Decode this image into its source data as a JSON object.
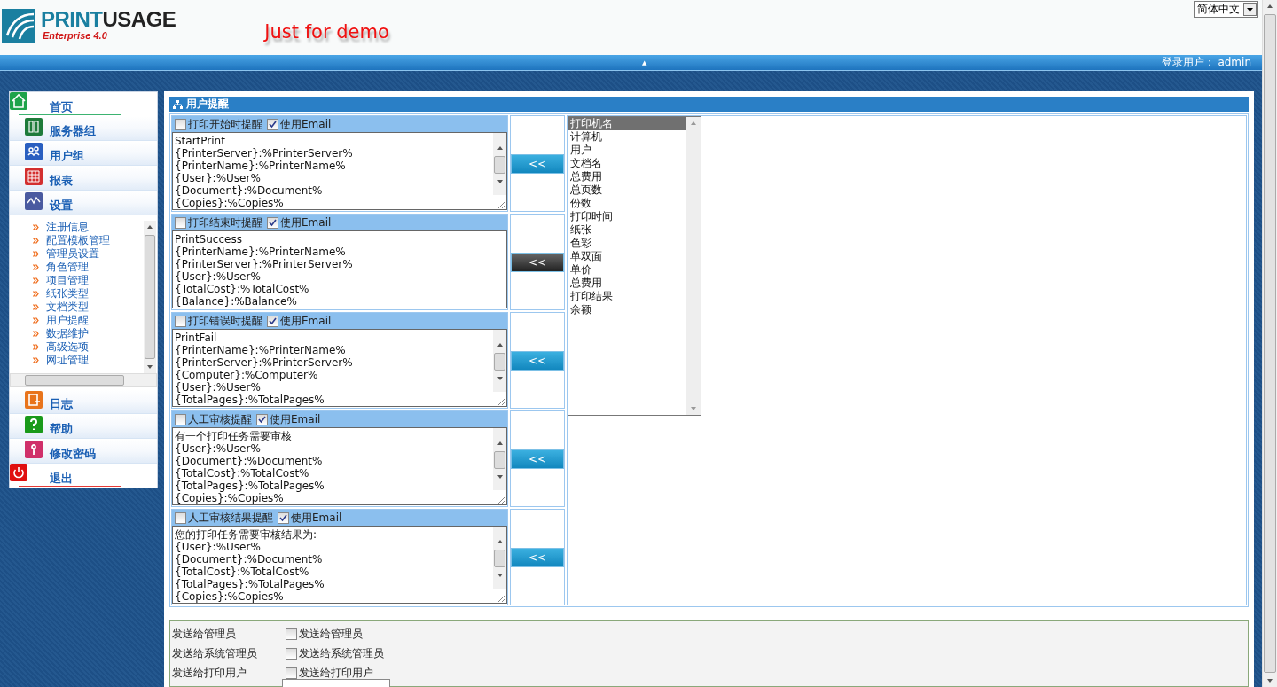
{
  "header": {
    "logo_primary": "PRINT",
    "logo_secondary": "USAGE",
    "edition": "Enterprise 4.0",
    "banner": "Just for demo",
    "language": "简体中文"
  },
  "top_bar": {
    "collapse_glyph": "▲",
    "login": "登录用户： admin"
  },
  "nav": [
    {
      "label": "首页",
      "kind": "link"
    },
    {
      "label": "服务器组",
      "kind": "tab"
    },
    {
      "label": "用户组",
      "kind": "tab"
    },
    {
      "label": "报表",
      "kind": "tab"
    },
    {
      "label": "设置",
      "kind": "tab",
      "expanded": true,
      "children": [
        {
          "label": "注册信息"
        },
        {
          "label": "配置模板管理"
        },
        {
          "label": "管理员设置"
        },
        {
          "label": "角色管理"
        },
        {
          "label": "项目管理"
        },
        {
          "label": "纸张类型"
        },
        {
          "label": "文档类型"
        },
        {
          "label": "用户提醒"
        },
        {
          "label": "数据维护"
        },
        {
          "label": "高级选项"
        },
        {
          "label": "网址管理"
        }
      ]
    },
    {
      "label": "日志",
      "kind": "tab"
    },
    {
      "label": "帮助",
      "kind": "tab"
    },
    {
      "label": "修改密码",
      "kind": "tab"
    },
    {
      "label": "退出",
      "kind": "link"
    }
  ],
  "panel": {
    "title": "用户提醒",
    "reminders": [
      {
        "label": "打印开始时提醒",
        "enabled": false,
        "use_email": true,
        "email_label": "使用Email",
        "scrollable": true,
        "button": "<<",
        "hover": false,
        "lines": [
          "StartPrint",
          "{PrinterServer}:%PrinterServer%",
          "{PrinterName}:%PrinterName%",
          "{User}:%User%",
          "{Document}:%Document%",
          "{Copies}:%Copies%"
        ]
      },
      {
        "label": "打印结束时提醒",
        "enabled": false,
        "use_email": true,
        "email_label": "使用Email",
        "scrollable": false,
        "button": "<<",
        "hover": true,
        "lines": [
          "PrintSuccess",
          "{PrinterName}:%PrinterName%",
          "{PrinterServer}:%PrinterServer%",
          "{User}:%User%",
          "{TotalCost}:%TotalCost%",
          "{Balance}:%Balance%"
        ]
      },
      {
        "label": "打印错误时提醒",
        "enabled": false,
        "use_email": true,
        "email_label": "使用Email",
        "scrollable": true,
        "button": "<<",
        "hover": false,
        "lines": [
          "PrintFail",
          "{PrinterName}:%PrinterName%",
          "{PrinterServer}:%PrinterServer%",
          "{Computer}:%Computer%",
          "{User}:%User%",
          "{TotalPages}:%TotalPages%"
        ]
      },
      {
        "label": "人工审核提醒",
        "enabled": false,
        "use_email": true,
        "email_label": "使用Email",
        "scrollable": true,
        "button": "<<",
        "hover": false,
        "lines": [
          "有一个打印任务需要审核",
          "{User}:%User%",
          "{Document}:%Document%",
          "{TotalCost}:%TotalCost%",
          "{TotalPages}:%TotalPages%",
          "{Copies}:%Copies%"
        ]
      },
      {
        "label": "人工审核结果提醒",
        "enabled": false,
        "use_email": true,
        "email_label": "使用Email",
        "scrollable": true,
        "button": "<<",
        "hover": false,
        "lines": [
          "您的打印任务需要审核结果为:",
          "{User}:%User%",
          "{Document}:%Document%",
          "{TotalCost}:%TotalCost%",
          "{TotalPages}:%TotalPages%",
          "{Copies}:%Copies%"
        ]
      }
    ],
    "fields": [
      {
        "label": "打印机名",
        "selected": true
      },
      {
        "label": "计算机",
        "selected": false
      },
      {
        "label": "用户",
        "selected": false
      },
      {
        "label": "文档名",
        "selected": false
      },
      {
        "label": "总费用",
        "selected": false
      },
      {
        "label": "总页数",
        "selected": false
      },
      {
        "label": "份数",
        "selected": false
      },
      {
        "label": "打印时间",
        "selected": false
      },
      {
        "label": "纸张",
        "selected": false
      },
      {
        "label": "色彩",
        "selected": false
      },
      {
        "label": "单双面",
        "selected": false
      },
      {
        "label": "单价",
        "selected": false
      },
      {
        "label": "总费用",
        "selected": false
      },
      {
        "label": "打印结果",
        "selected": false
      },
      {
        "label": "余额",
        "selected": false
      }
    ]
  },
  "recipients": [
    {
      "label": "发送给管理员",
      "option": "发送给管理员",
      "checked": false
    },
    {
      "label": "发送给系统管理员",
      "option": "发送给系统管理员",
      "checked": false
    },
    {
      "label": "发送给打印用户",
      "option": "发送给打印用户",
      "checked": false
    }
  ]
}
